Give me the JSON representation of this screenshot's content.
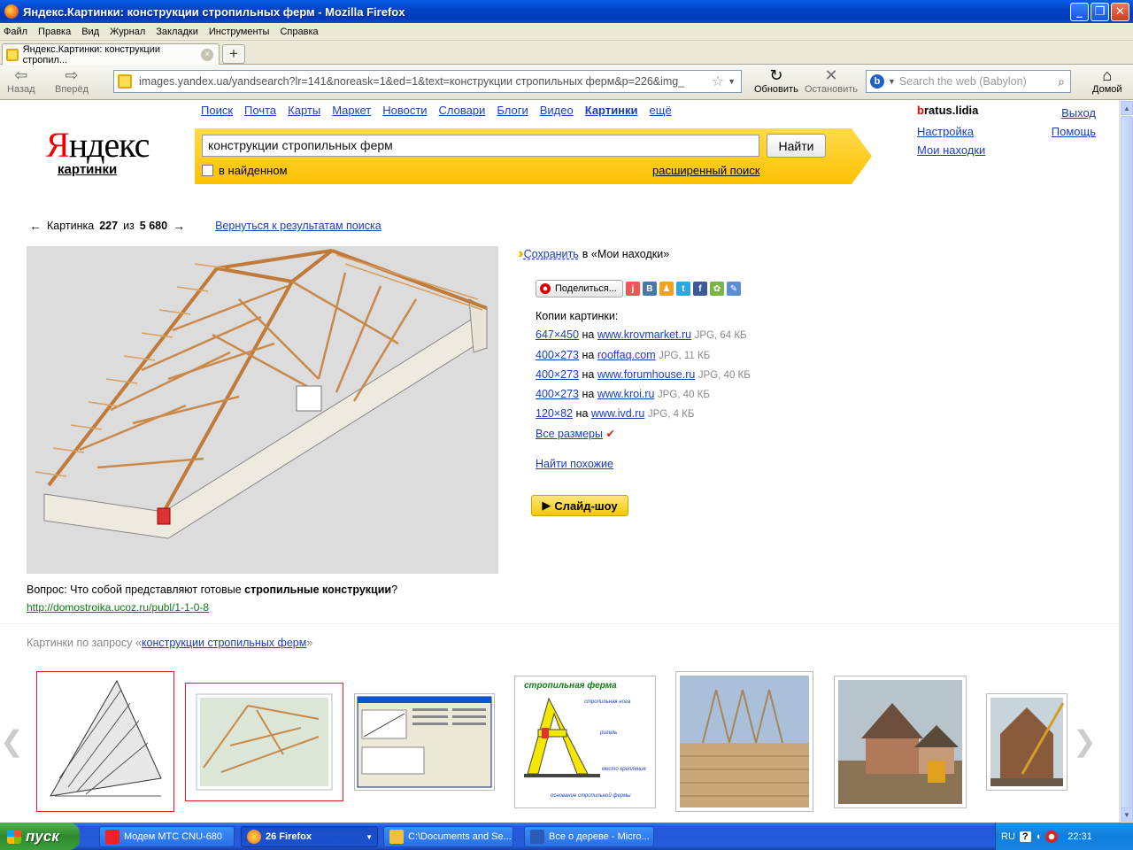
{
  "window": {
    "title": "Яндекс.Картинки: конструкции стропильных ферм - Mozilla Firefox"
  },
  "menu": [
    "Файл",
    "Правка",
    "Вид",
    "Журнал",
    "Закладки",
    "Инструменты",
    "Справка"
  ],
  "tab": {
    "label": "Яндекс.Картинки: конструкции стропил...",
    "close": "×",
    "new_tab": "+"
  },
  "nav": {
    "back": "Назад",
    "forward": "Вперёд",
    "reload": "Обновить",
    "stop": "Остановить",
    "home": "Домой",
    "url": "images.yandex.ua/yandsearch?lr=141&noreask=1&ed=1&text=конструкции стропильных ферм&p=226&img_",
    "search_placeholder": "Search the web (Babylon)"
  },
  "header": {
    "logo_ya": "Я",
    "logo_rest": "ндекс",
    "logo_sub": "картинки",
    "services": [
      "Поиск",
      "Почта",
      "Карты",
      "Маркет",
      "Новости",
      "Словари",
      "Блоги",
      "Видео",
      "Картинки",
      "ещё"
    ],
    "query": "конструкции стропильных ферм",
    "find_button": "Найти",
    "in_found": "в найденном",
    "advanced": "расширенный поиск",
    "user_first": "b",
    "user_rest": "ratus.lidia",
    "user_links": [
      "Настройка",
      "Мои находки"
    ],
    "right_links": [
      "Выход",
      "Помощь"
    ]
  },
  "pager": {
    "prev_arrow": "←",
    "label": "Картинка",
    "current": "227",
    "of": "из",
    "total": "5 680",
    "next_arrow": "→",
    "back_link": "Вернуться к результатам поиска"
  },
  "details": {
    "save_link": "Сохранить",
    "save_rest": "в «Мои находки»",
    "share_button": "Поделиться...",
    "copies_title": "Копии картинки:",
    "copies": [
      {
        "size": "647×450",
        "on": "на",
        "site": "www.krovmarket.ru",
        "info": "JPG, 64 КБ"
      },
      {
        "size": "400×273",
        "on": "на",
        "site": "rooffaq.com",
        "info": "JPG, 11 КБ"
      },
      {
        "size": "400×273",
        "on": "на",
        "site": "www.forumhouse.ru",
        "info": "JPG, 40 КБ"
      },
      {
        "size": "400×273",
        "on": "на",
        "site": "www.kroi.ru",
        "info": "JPG, 40 КБ"
      },
      {
        "size": "120×82",
        "on": "на",
        "site": "www.ivd.ru",
        "info": "JPG, 4 КБ"
      }
    ],
    "all_sizes": "Все размеры",
    "find_similar": "Найти похожие",
    "slideshow": "Слайд-шоу",
    "question_prefix": "Вопрос: Что собой представляют готовые ",
    "question_bold": "стропильные конструкции",
    "question_suffix": "?",
    "source_url": "http://domostroika.ucoz.ru/publ/1-1-0-8"
  },
  "related": {
    "prefix": "Картинки по запросу «",
    "query": "конструкции стропильных ферм",
    "suffix": "»",
    "diagram_title": "стропильная ферма",
    "diagram_labels": [
      "стропильная нога",
      "ригель",
      "место крепления",
      "основание стропильной фермы"
    ]
  },
  "taskbar": {
    "start": "пуск",
    "items": [
      "Модем МТС CNU-680",
      "26 Firefox",
      "C:\\Documents and Se...",
      "Все о дереве - Micro..."
    ],
    "lang": "RU",
    "clock": "22:31"
  },
  "colors": {
    "yandex_red": "#e00000",
    "yandex_yellow": "#fcc100",
    "link": "#1a3dc1",
    "source_green": "#0a7a0a"
  }
}
